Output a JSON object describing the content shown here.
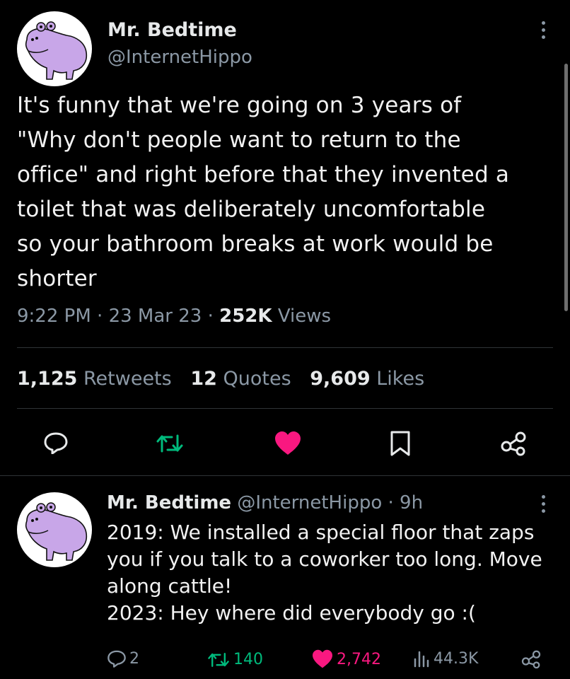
{
  "main_tweet": {
    "display_name": "Mr. Bedtime",
    "handle": "@InternetHippo",
    "lines": [
      "It's funny that we're going on 3 years of",
      "\"Why don't people want to return to the",
      "office\" and right before that they invented a",
      "toilet that was deliberately uncomfortable",
      "so your bathroom breaks at work would be",
      "shorter"
    ],
    "time": "9:22 PM",
    "date": "23 Mar 23",
    "views_count": "252K",
    "views_label": "Views",
    "sep": "·",
    "retweets_count": "1,125",
    "retweets_label": "Retweets",
    "quotes_count": "12",
    "quotes_label": "Quotes",
    "likes_count": "9,609",
    "likes_label": "Likes",
    "actions": [
      "reply-icon",
      "retweet-icon",
      "like-icon",
      "bookmark-icon",
      "share-icon"
    ]
  },
  "reply_tweet": {
    "display_name": "Mr. Bedtime",
    "handle": "@InternetHippo",
    "age": "· 9h",
    "lines": [
      "2019: We installed a special floor that zaps",
      "you if you talk to a coworker too long. Move",
      "along cattle!",
      "2023: Hey where did everybody go :("
    ],
    "reply_count": "2",
    "retweet_count": "140",
    "like_count": "2,742",
    "views_count": "44.3K"
  },
  "colors": {
    "background": "#000000",
    "text": "#e7e9ea",
    "muted": "#8b98a5",
    "retweet_green": "#00ba7c",
    "like_pink": "#f91880",
    "avatar_purple": "#c8a6e8"
  }
}
